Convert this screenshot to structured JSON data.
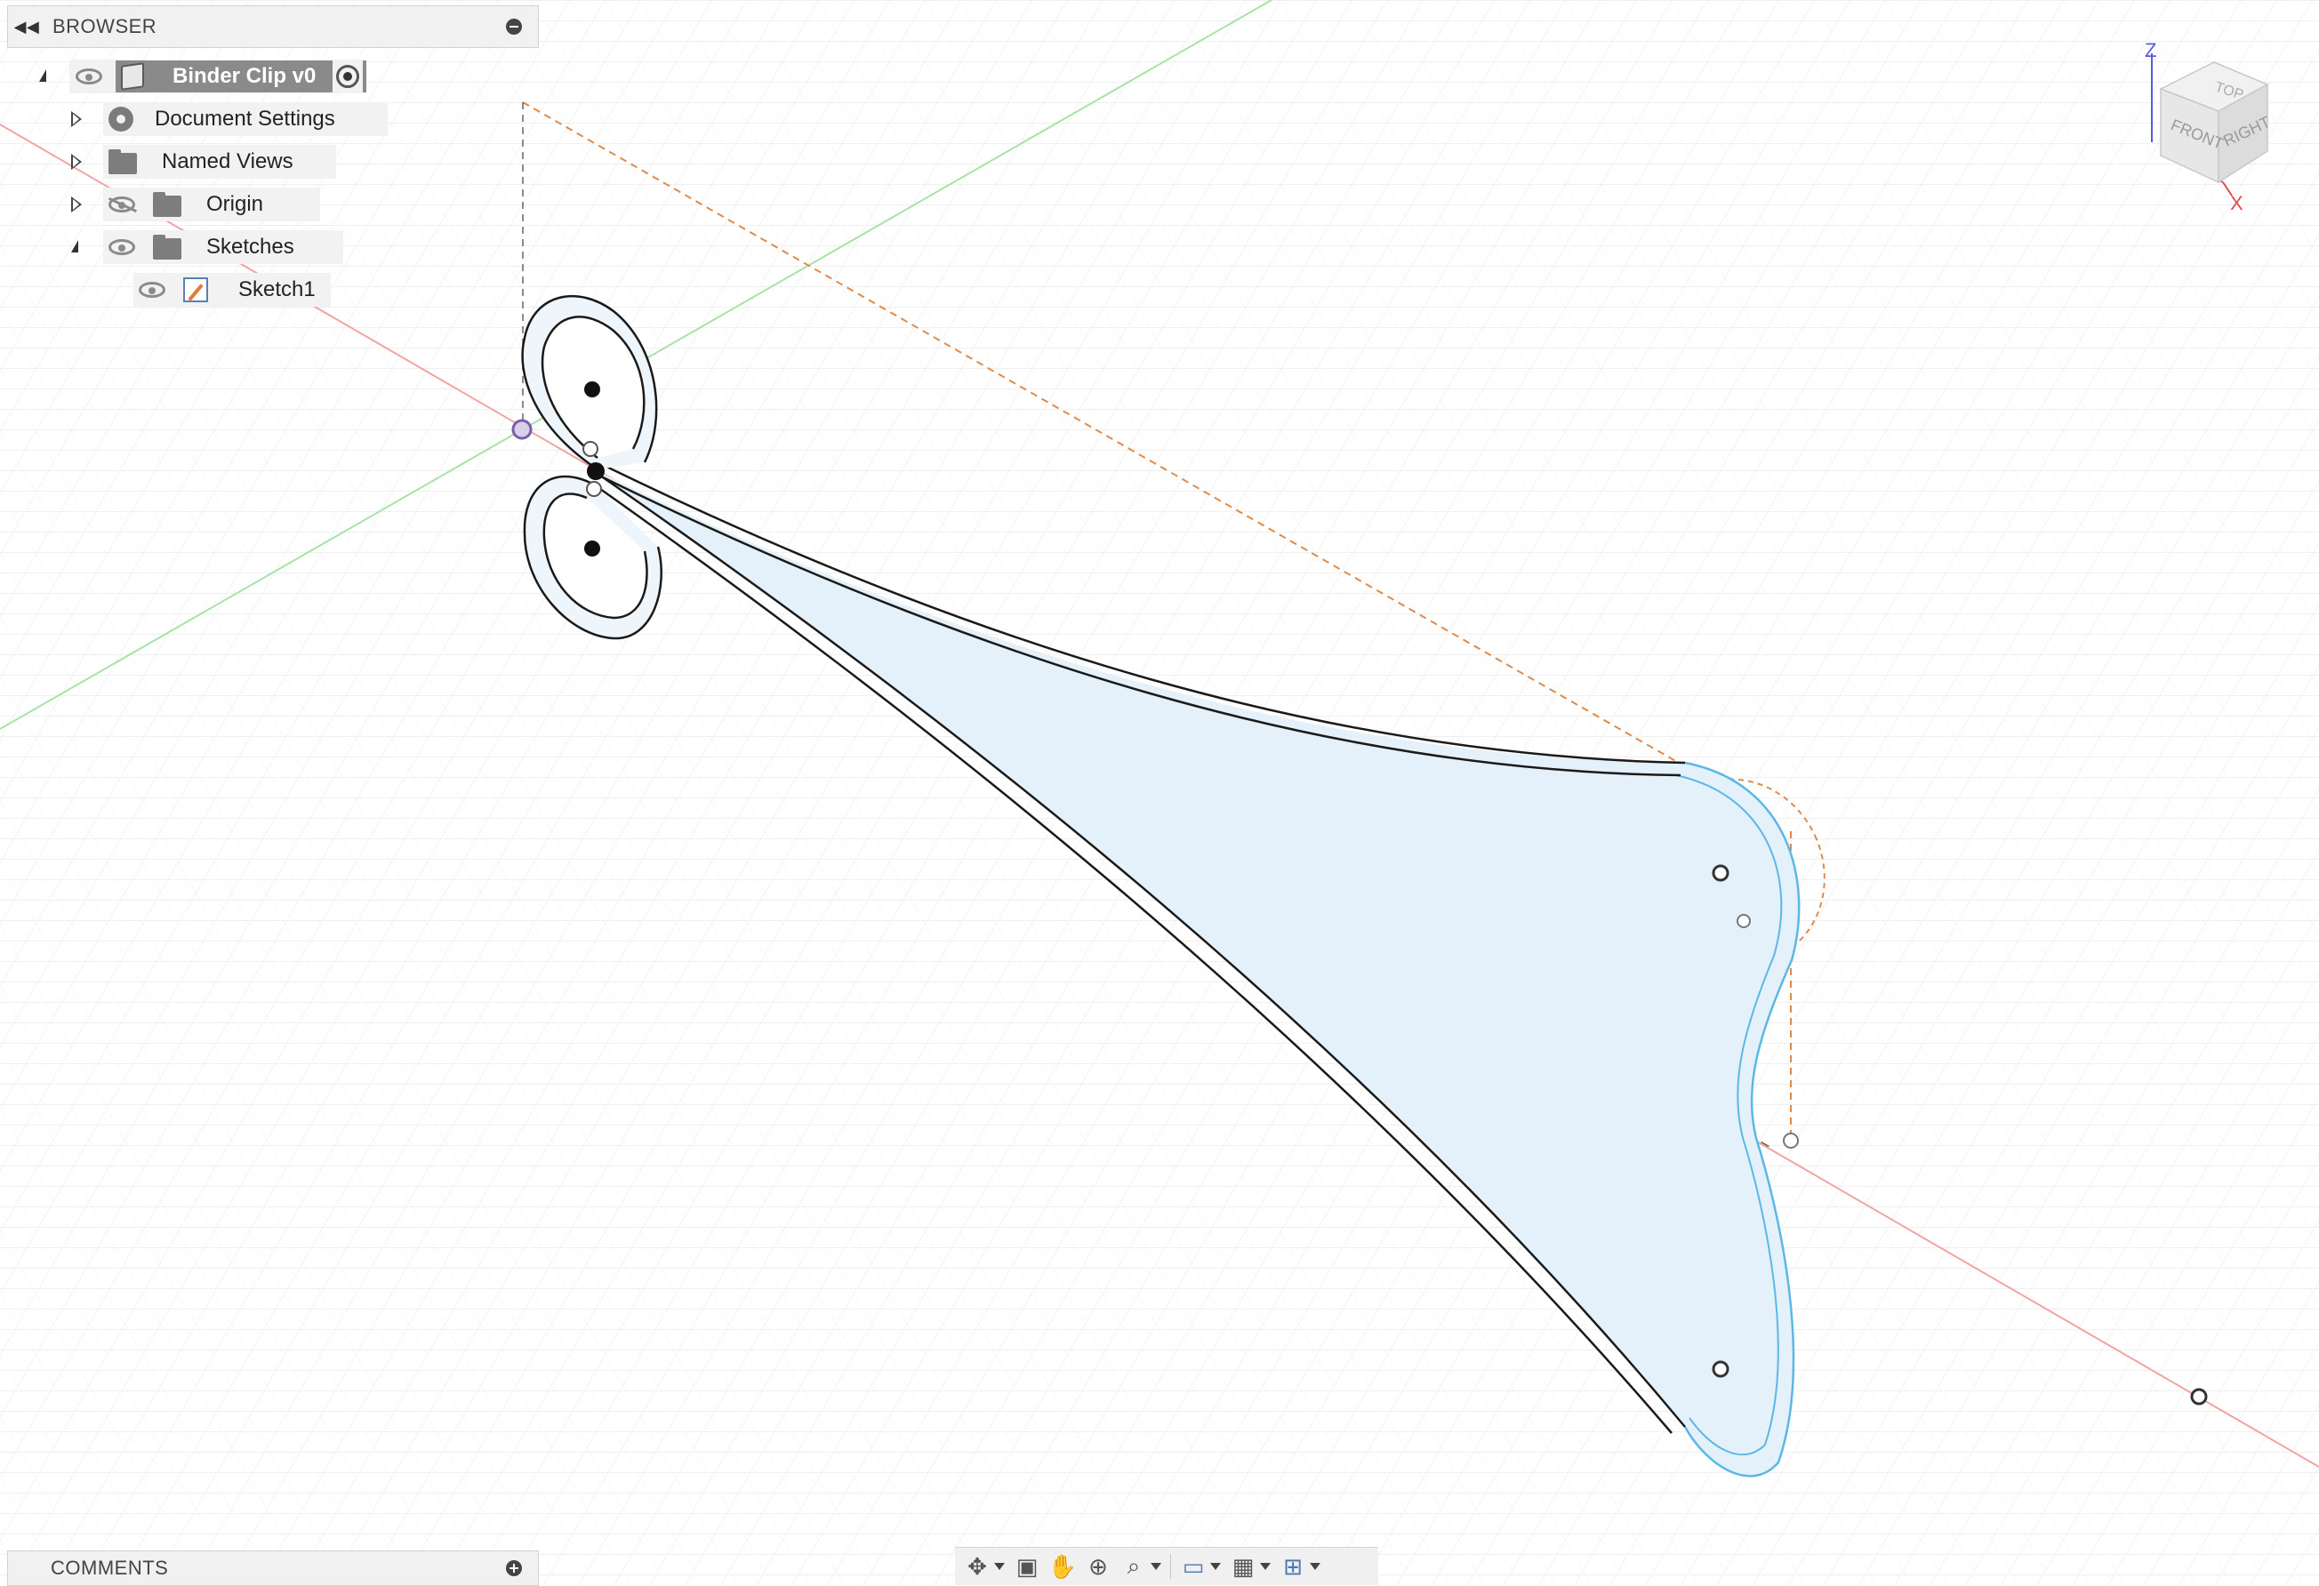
{
  "browser": {
    "header_title": "BROWSER",
    "tree": {
      "root_label": "Binder Clip v0",
      "items": [
        {
          "label": "Document Settings",
          "icon": "gear-icon",
          "expanded": false
        },
        {
          "label": "Named Views",
          "icon": "folder-icon",
          "expanded": false
        },
        {
          "label": "Origin",
          "icon": "folder-icon",
          "expanded": false,
          "visibility": "hidden"
        },
        {
          "label": "Sketches",
          "icon": "folder-icon",
          "expanded": true,
          "visibility": "visible"
        }
      ],
      "sketch_child": {
        "label": "Sketch1",
        "icon": "sketch-icon",
        "visibility": "visible"
      }
    }
  },
  "comments": {
    "header_title": "COMMENTS"
  },
  "view_cube": {
    "faces": [
      "TOP",
      "FRONT",
      "RIGHT"
    ],
    "axes": [
      "Z",
      "X"
    ],
    "colors": {
      "z_axis": "#5a5adc",
      "x_axis": "#e04a4a",
      "y_axis": "#6fd36f"
    }
  },
  "toolbar": {
    "buttons": [
      {
        "name": "orbit-button",
        "icon": "orbit-icon",
        "has_menu": true
      },
      {
        "name": "look-at-button",
        "icon": "look-at-icon",
        "has_menu": false
      },
      {
        "name": "pan-button",
        "icon": "hand-icon",
        "has_menu": false
      },
      {
        "name": "zoom-button",
        "icon": "zoom-icon",
        "has_menu": false
      },
      {
        "name": "fit-button",
        "icon": "zoom-window-icon",
        "has_menu": true
      },
      {
        "name": "display-settings-button",
        "icon": "display-icon",
        "has_menu": true
      },
      {
        "name": "grid-settings-button",
        "icon": "grid-icon",
        "has_menu": true
      },
      {
        "name": "viewports-button",
        "icon": "viewports-icon",
        "has_menu": true
      }
    ]
  },
  "colors": {
    "profile_fill": "#e4f1fa",
    "profile_edge": "#5bb8e6",
    "sketch_line": "#1a1a1a",
    "construction_line": "#e08a4a",
    "grid_line": "#e6e6e6"
  }
}
